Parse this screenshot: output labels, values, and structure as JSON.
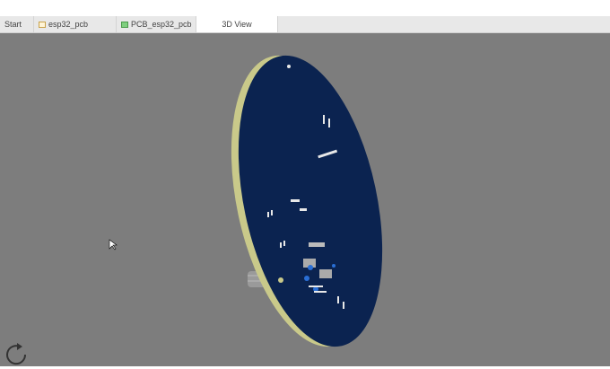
{
  "tabs": [
    {
      "label": "Start",
      "icon": "none"
    },
    {
      "label": "esp32_pcb",
      "icon": "folder-icon"
    },
    {
      "label": "PCB_esp32_pcb",
      "icon": "pcb-icon"
    },
    {
      "label": "3D View",
      "icon": "none",
      "active": true
    }
  ],
  "colors": {
    "background": "#7d7d7d",
    "board": "#0b2350",
    "board_edge": "#c9c98a",
    "accent": "#2a6fd6"
  }
}
